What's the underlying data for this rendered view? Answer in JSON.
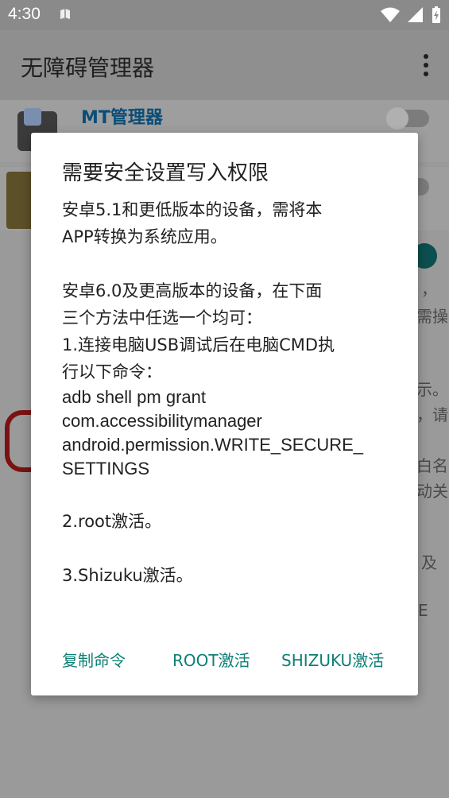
{
  "status_bar": {
    "time": "4:30"
  },
  "app_bar": {
    "title": "无障碍管理器"
  },
  "background": {
    "item1_label": "MT管理器",
    "side_fragments": [
      "，",
      "需操",
      "示。",
      "，请",
      "白名",
      "动关",
      "及",
      "E"
    ]
  },
  "dialog": {
    "title": "需要安全设置写入权限",
    "body": {
      "para1_line1": "安卓5.1和更低版本的设备，需将本",
      "para1_line2": "APP转换为系统应用。",
      "para2_line1": "安卓6.0及更高版本的设备，在下面",
      "para2_line2": "三个方法中任选一个均可：",
      "method1_line1": "1.连接电脑USB调试后在电脑CMD执",
      "method1_line2": "行以下命令：",
      "cmd_line1": "adb shell pm grant",
      "cmd_line2": "com.accessibilitymanager",
      "cmd_line3": "android.permission.WRITE_SECURE_",
      "cmd_line4": "SETTINGS",
      "method2": "2.root激活。",
      "method3": "3.Shizuku激活。"
    },
    "buttons": {
      "copy": "复制命令",
      "root": "ROOT激活",
      "shizuku": "SHIZUKU激活"
    }
  },
  "colors": {
    "accent": "#0d8075",
    "scrim": "#8a8a8a"
  }
}
